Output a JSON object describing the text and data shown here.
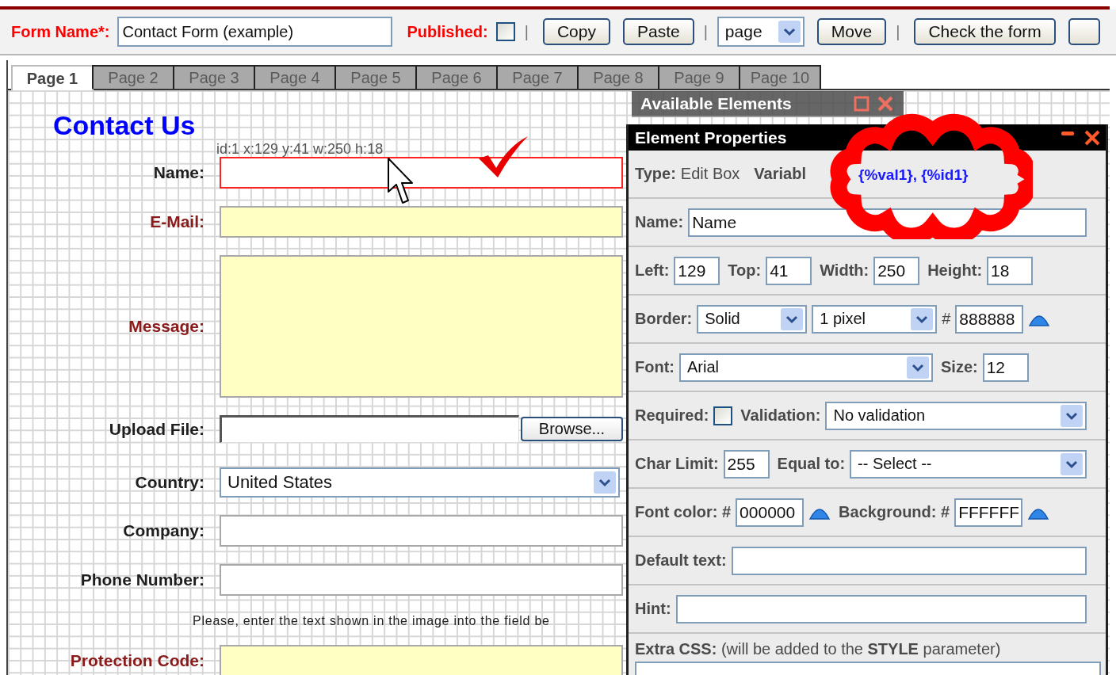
{
  "toolbar": {
    "items": [
      {
        "kind": "label",
        "text": "Form Name*:"
      },
      {
        "kind": "input",
        "value": "Contact Form (example)"
      },
      {
        "kind": "label",
        "text": "Published:"
      },
      {
        "kind": "checkbox",
        "checked": false
      },
      {
        "kind": "separator",
        "text": "|"
      },
      {
        "kind": "button",
        "label": "Copy"
      },
      {
        "kind": "button",
        "label": "Paste"
      },
      {
        "kind": "separator",
        "text": "|"
      },
      {
        "kind": "select",
        "value": "page"
      },
      {
        "kind": "button",
        "label": "Move"
      },
      {
        "kind": "separator",
        "text": "|"
      },
      {
        "kind": "button",
        "label": "Check the form"
      },
      {
        "kind": "button"
      }
    ]
  },
  "tabs": [
    {
      "label": "Page 1",
      "selected": true
    },
    {
      "label": "Page 2",
      "selected": false
    },
    {
      "label": "Page 3",
      "selected": false
    },
    {
      "label": "Page 4",
      "selected": false
    },
    {
      "label": "Page 5",
      "selected": false
    },
    {
      "label": "Page 6",
      "selected": false
    },
    {
      "label": "Page 7",
      "selected": false
    },
    {
      "label": "Page 8",
      "selected": false
    },
    {
      "label": "Page 9",
      "selected": false
    },
    {
      "label": "Page 10",
      "selected": false
    }
  ],
  "form": {
    "title": "Contact Us",
    "element_info": "id:1 x:129 y:41 w:250 h:18",
    "fields": [
      {
        "kind": "text",
        "label": "Name:",
        "required": false,
        "selected": true
      },
      {
        "kind": "text",
        "label": "E-Mail:",
        "required": true,
        "selected": false
      },
      {
        "kind": "textarea",
        "label": "Message:",
        "required": true,
        "selected": false
      },
      {
        "kind": "file",
        "label": "Upload File:",
        "button": "Browse...",
        "required": false,
        "selected": false
      },
      {
        "kind": "select",
        "label": "Country:",
        "value": "United States",
        "required": false,
        "selected": false
      },
      {
        "kind": "text",
        "label": "Company:",
        "required": false,
        "selected": false
      },
      {
        "kind": "text",
        "label": "Phone Number:",
        "required": false,
        "selected": false
      },
      {
        "kind": "note",
        "text": "Please, enter the text shown in the image into the field be"
      },
      {
        "kind": "text",
        "label": "Protection Code:",
        "required": true,
        "selected": false
      }
    ]
  },
  "available_elements": {
    "title": "Available Elements"
  },
  "element_properties": {
    "title": "Element Properties",
    "type_label": "Type:",
    "type": "Edit Box",
    "variables_label": "Variabl",
    "variables": "{%val1}, {%id1}",
    "rows": [
      {
        "items": [
          {
            "kind": "label",
            "text": "Name:"
          },
          {
            "kind": "text",
            "value": "Name"
          }
        ]
      },
      {
        "items": [
          {
            "kind": "label",
            "text": "Left:"
          },
          {
            "kind": "number",
            "value": "129"
          },
          {
            "kind": "label",
            "text": "Top:"
          },
          {
            "kind": "number",
            "value": "41"
          },
          {
            "kind": "label",
            "text": "Width:"
          },
          {
            "kind": "number",
            "value": "250"
          },
          {
            "kind": "label",
            "text": "Height:"
          },
          {
            "kind": "number",
            "value": "18"
          }
        ]
      },
      {
        "items": [
          {
            "kind": "label",
            "text": "Border:"
          },
          {
            "kind": "select",
            "value": "Solid"
          },
          {
            "kind": "select",
            "value": "1 pixel"
          },
          {
            "kind": "hash",
            "text": "#"
          },
          {
            "kind": "hex",
            "value": "888888"
          },
          {
            "kind": "picker"
          }
        ]
      },
      {
        "items": [
          {
            "kind": "label",
            "text": "Font:"
          },
          {
            "kind": "select",
            "value": "Arial"
          },
          {
            "kind": "label",
            "text": "Size:"
          },
          {
            "kind": "number",
            "value": "12"
          }
        ]
      },
      {
        "items": [
          {
            "kind": "label",
            "text": "Required:"
          },
          {
            "kind": "checkbox",
            "checked": false
          },
          {
            "kind": "label",
            "text": "Validation:"
          },
          {
            "kind": "select",
            "value": "No validation"
          }
        ]
      },
      {
        "items": [
          {
            "kind": "label",
            "text": "Char Limit:"
          },
          {
            "kind": "number",
            "value": "255"
          },
          {
            "kind": "label",
            "text": "Equal to:"
          },
          {
            "kind": "select",
            "value": "-- Select --"
          }
        ]
      },
      {
        "items": [
          {
            "kind": "label",
            "text": "Font color: #"
          },
          {
            "kind": "hex",
            "value": "000000"
          },
          {
            "kind": "picker"
          },
          {
            "kind": "label",
            "text": "Background: #"
          },
          {
            "kind": "hex",
            "value": "FFFFFF"
          },
          {
            "kind": "picker"
          }
        ]
      },
      {
        "items": [
          {
            "kind": "label",
            "text": "Default text:"
          },
          {
            "kind": "text"
          }
        ]
      },
      {
        "items": [
          {
            "kind": "label",
            "text": "Hint:"
          },
          {
            "kind": "text"
          }
        ]
      }
    ],
    "extra_css_label": "**Extra CSS:** (will be added to the **STYLE** parameter)"
  }
}
